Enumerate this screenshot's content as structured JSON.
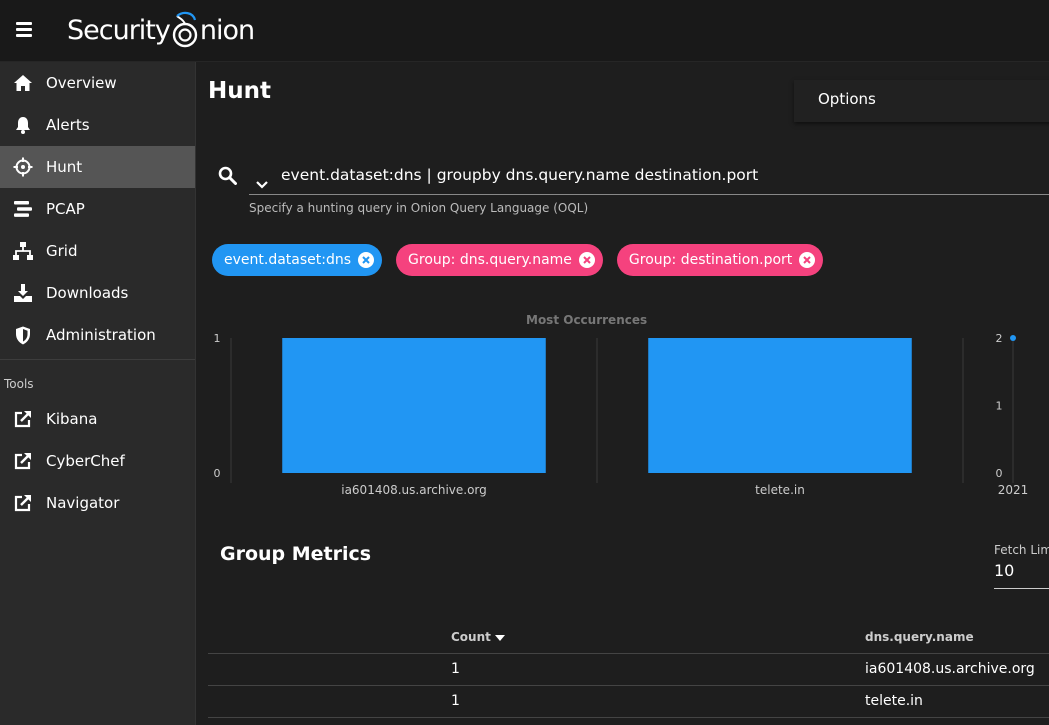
{
  "app": {
    "brand": "Security Onion"
  },
  "sidebar": {
    "items": [
      {
        "label": "Overview",
        "icon": "home-icon"
      },
      {
        "label": "Alerts",
        "icon": "bell-icon"
      },
      {
        "label": "Hunt",
        "icon": "crosshairs-icon",
        "active": true
      },
      {
        "label": "PCAP",
        "icon": "stream-icon"
      },
      {
        "label": "Grid",
        "icon": "sitemap-icon"
      },
      {
        "label": "Downloads",
        "icon": "download-icon"
      },
      {
        "label": "Administration",
        "icon": "shield-icon"
      }
    ],
    "tools_header": "Tools",
    "tools": [
      {
        "label": "Kibana",
        "icon": "external-link-icon"
      },
      {
        "label": "CyberChef",
        "icon": "external-link-icon"
      },
      {
        "label": "Navigator",
        "icon": "external-link-icon"
      }
    ]
  },
  "main": {
    "title": "Hunt",
    "options_label": "Options",
    "query": "event.dataset:dns | groupby dns.query.name destination.port",
    "query_hint": "Specify a hunting query in Onion Query Language (OQL)",
    "chips": [
      {
        "label": "event.dataset:dns",
        "color": "#2196f3"
      },
      {
        "label": "Group: dns.query.name",
        "color": "#f5427e"
      },
      {
        "label": "Group: destination.port",
        "color": "#f5427e"
      }
    ],
    "group_metrics_title": "Group Metrics",
    "fetch_limit_label": "Fetch Limit",
    "fetch_limit_value": "10",
    "table": {
      "headers": [
        "Count",
        "dns.query.name"
      ],
      "rows": [
        {
          "count": "1",
          "dns": "ia601408.us.archive.org"
        },
        {
          "count": "1",
          "dns": "telete.in"
        }
      ]
    }
  },
  "chart_data": [
    {
      "type": "bar",
      "title": "Most Occurrences",
      "categories": [
        "ia601408.us.archive.org",
        "telete.in"
      ],
      "values": [
        1,
        1
      ],
      "ylim": [
        0,
        1
      ],
      "yticks": [
        "0",
        "1"
      ],
      "color": "#2196f3"
    },
    {
      "type": "line",
      "title": "",
      "x": [
        "2021"
      ],
      "values": [
        2
      ],
      "ylim": [
        0,
        2
      ],
      "yticks": [
        "0",
        "1",
        "2"
      ],
      "color": "#2196f3"
    }
  ]
}
